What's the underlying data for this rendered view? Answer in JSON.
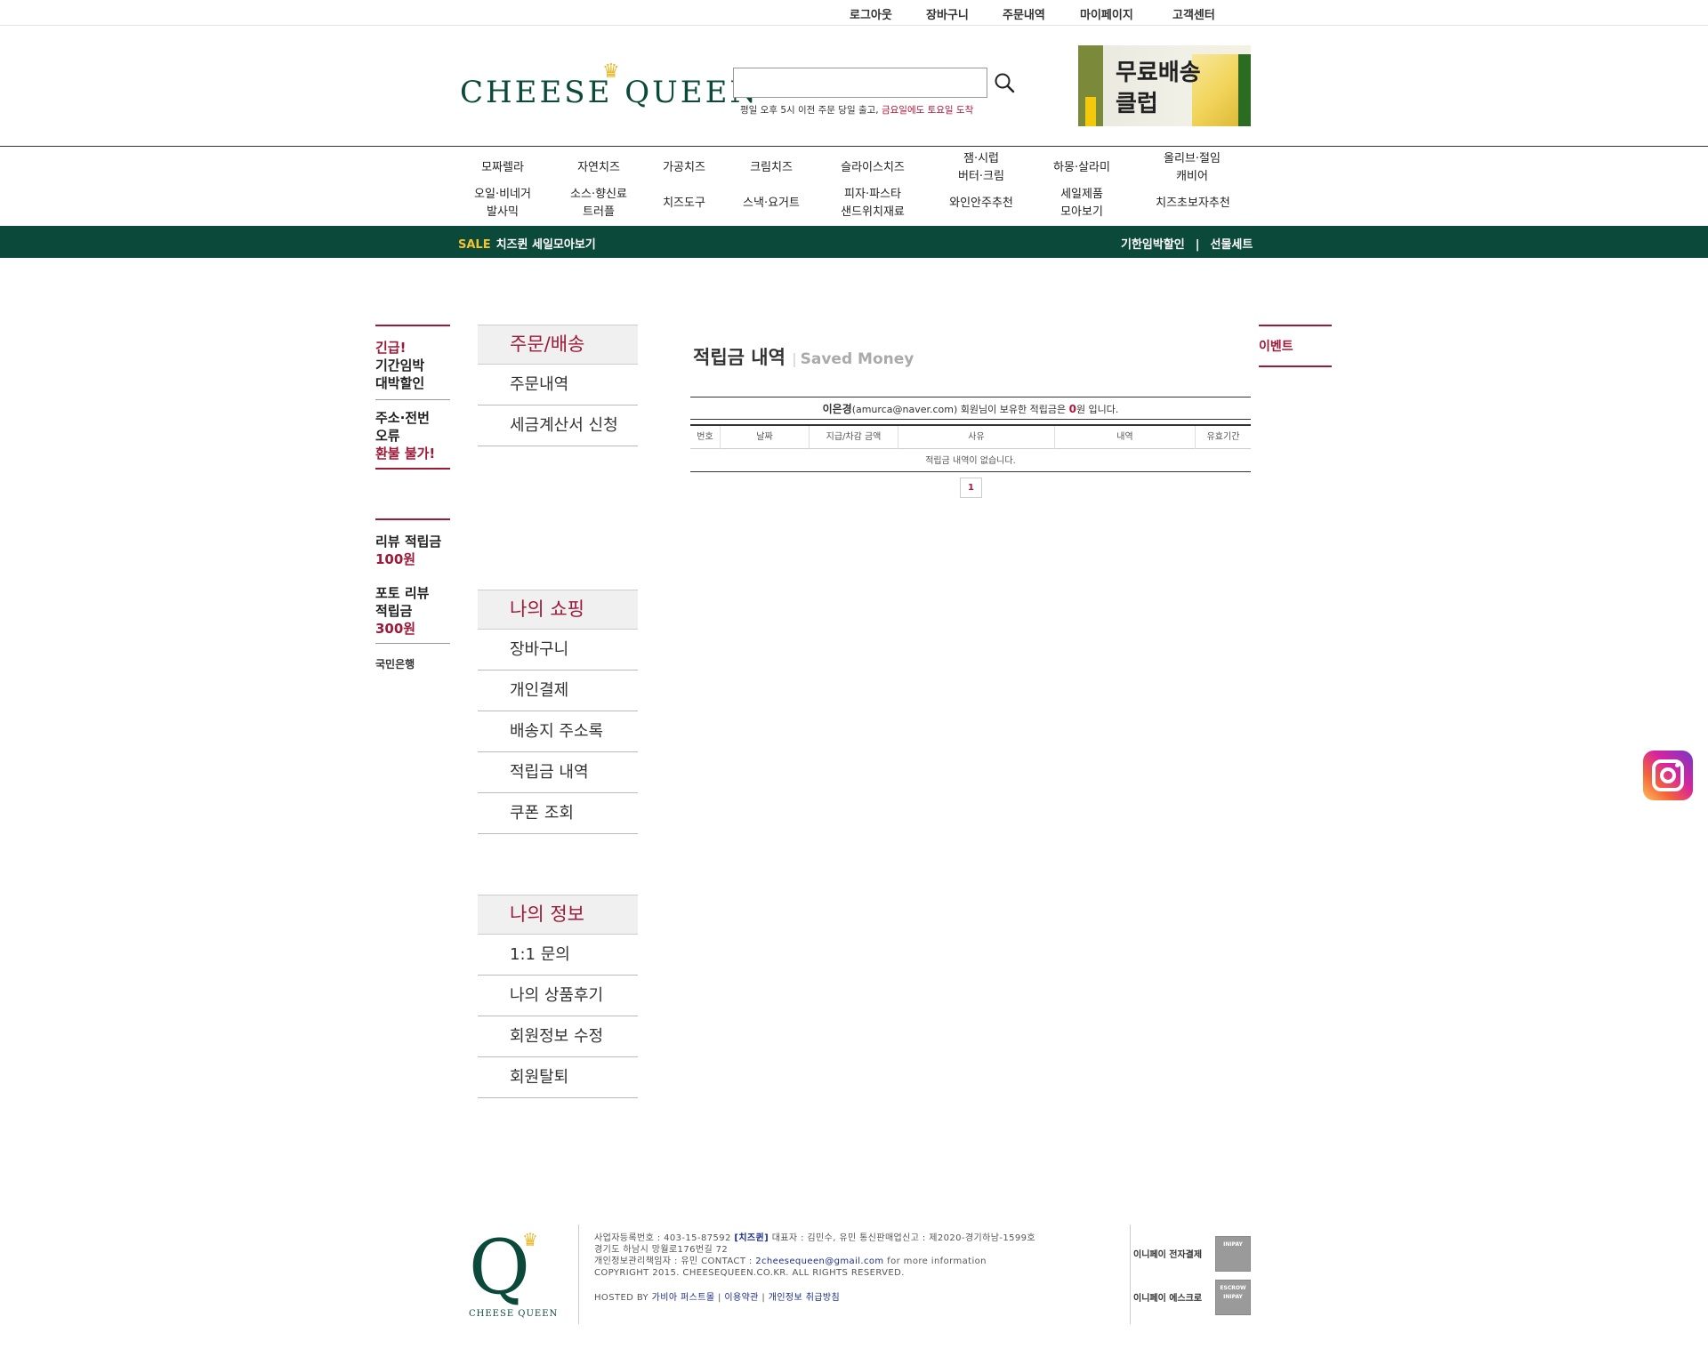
{
  "topbar": {
    "links": [
      "로그아웃",
      "장바구니",
      "주문내역",
      "마이페이지",
      "고객센터"
    ]
  },
  "header": {
    "logo_text": "CHEESE QUEEN",
    "search_placeholder": "",
    "ship_note_prefix": "평일 오후 5시 이전 주문 당일 출고, ",
    "ship_note_highlight": "금요일에도 토요일 도착",
    "banner_line1": "무료배송",
    "banner_line2": "클럽"
  },
  "categories": {
    "row1": [
      "모짜렐라",
      "자연치즈",
      "가공치즈",
      "크림치즈",
      "슬라이스치즈",
      "잼·시럽\n버터·크림",
      "하몽·살라미",
      "올리브·절임\n캐비어"
    ],
    "row2": [
      "오일·비네거\n발사믹",
      "소스·향신료\n트러플",
      "치즈도구",
      "스낵·요거트",
      "피자·파스타\n샌드위치재료",
      "와인안주추천",
      "세일제품\n모아보기",
      "치즈초보자추천"
    ]
  },
  "greenbar": {
    "sale_tag": "SALE",
    "sale_text": "치즈퀸 세일모아보기",
    "right_1": "기한임박할인",
    "sep": "|",
    "right_2": "선물세트"
  },
  "notices": {
    "n1_red": "긴급!",
    "n1_text": "기간임박\n대박할인",
    "n2_text": "주소·전번\n오류",
    "n2_red": "환불 불가!",
    "n3_text": "리뷰 적립금",
    "n3_red": "100원",
    "n4_text": "포토 리뷰\n적립금",
    "n4_red": "300원",
    "bank": "국민은행"
  },
  "sidemenu": {
    "group1": {
      "title": "주문/배송",
      "items": [
        "주문내역",
        "세금계산서 신청"
      ]
    },
    "group2": {
      "title": "나의 쇼핑",
      "items": [
        "장바구니",
        "개인결제",
        "배송지 주소록",
        "적립금 내역",
        "쿠폰 조회"
      ]
    },
    "group3": {
      "title": "나의 정보",
      "items": [
        "1:1 문의",
        "나의 상품후기",
        "회원정보 수정",
        "회원탈퇴"
      ]
    }
  },
  "main": {
    "title": "적립금 내역",
    "title_sep": "|",
    "title_sub": "Saved Money",
    "user_name": "이은경",
    "user_email": "(amurca@naver.com)",
    "info_mid": " 회원님이 보유한 적립금은 ",
    "points": "0",
    "info_end": "원 입니다.",
    "columns": [
      "번호",
      "날짜",
      "지급/차감 금액",
      "사유",
      "내역",
      "유효기간"
    ],
    "empty_text": "적립금 내역이 없습니다.",
    "page": "1"
  },
  "event": {
    "label": "이벤트"
  },
  "footer": {
    "logo_letter": "Q",
    "logo_name": "CHEESE QUEEN",
    "line1_a": "사업자등록번호 : 403-15-87592  ",
    "line1_brand": "[치즈퀸]",
    "line1_b": " 대표자 : 김민수, 유민 통신판매업신고 : 제2020-경기하남-1599호",
    "line2": "경기도 하남시 망월로176번길 72",
    "line3_a": "개인정보관리책임자 : 유민 CONTACT : ",
    "line3_email": "2cheesequeen@gmail.com",
    "line3_b": " for more information",
    "line4": "COPYRIGHT 2015. CHEESEQUEEN.CO.KR. ALL RIGHTS RESERVED.",
    "hosted_a": "HOSTED BY ",
    "hosted_link": "가비아 퍼스트몰",
    "terms": "이용약관",
    "privacy": "개인정보 취급방침",
    "pay1": "이니페이 전자결제",
    "pay2": "이니페이 에스크로",
    "badge1": "INIPAY",
    "badge2": "ESCROW INIPAY"
  }
}
